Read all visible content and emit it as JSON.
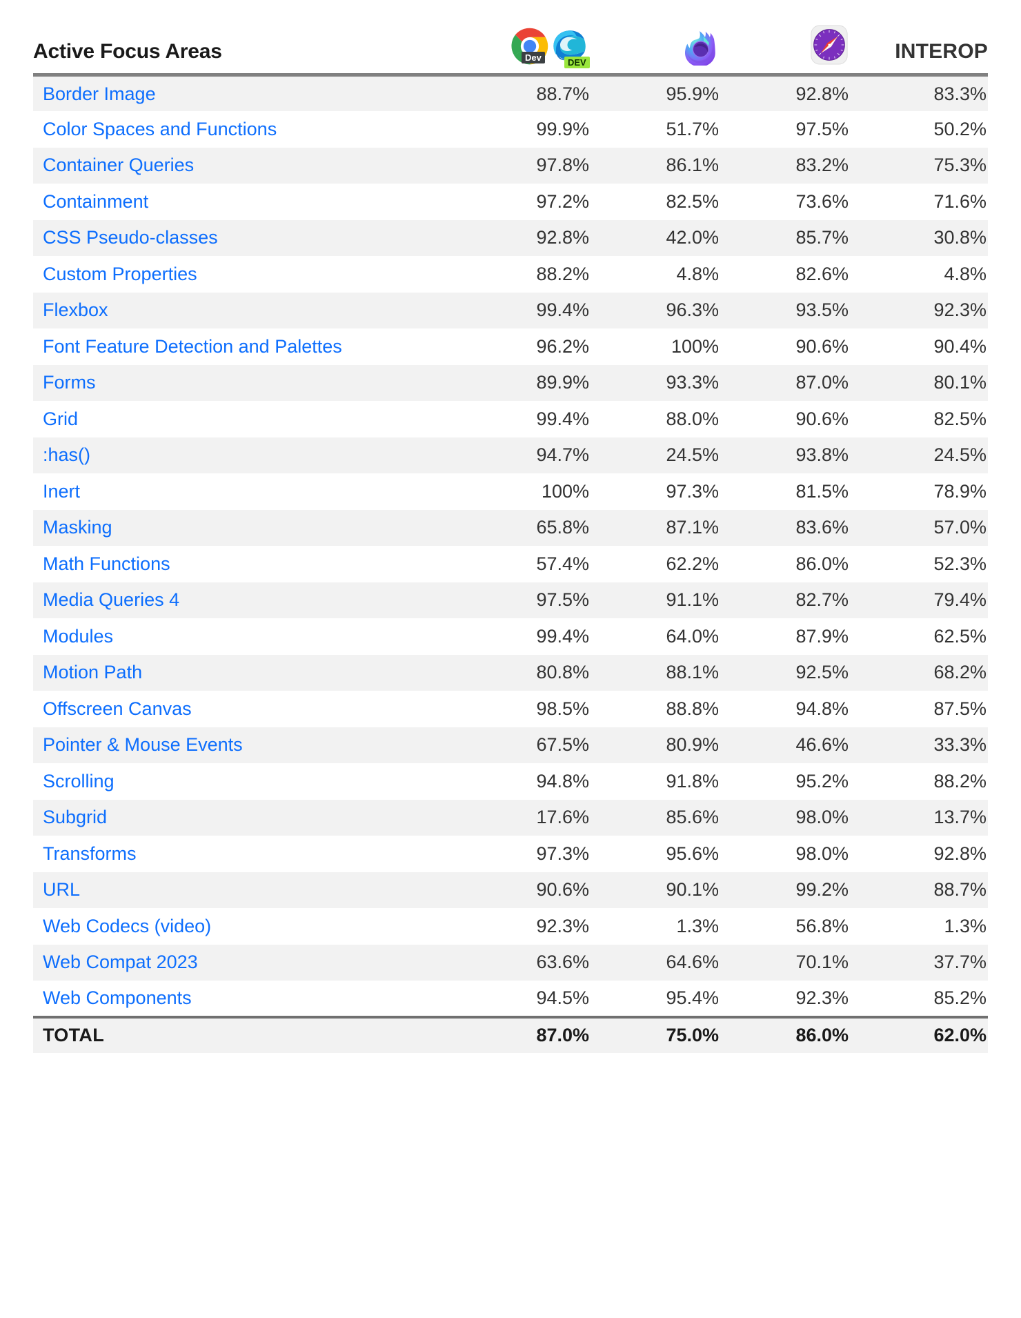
{
  "header": {
    "title": "Active Focus Areas",
    "interop_label": "INTEROP",
    "browsers": [
      {
        "name": "chrome-dev-and-edge-dev",
        "icons": [
          "chrome-dev-icon",
          "edge-dev-icon"
        ],
        "badge1": "Dev",
        "badge2": "DEV"
      },
      {
        "name": "firefox-nightly",
        "icons": [
          "firefox-nightly-icon"
        ]
      },
      {
        "name": "safari-technology-preview",
        "icons": [
          "safari-technology-preview-icon"
        ]
      }
    ],
    "columns": [
      "Active Focus Areas",
      "Chrome Dev / Edge Dev",
      "Firefox Nightly",
      "Safari Technology Preview",
      "INTEROP"
    ]
  },
  "colors": {
    "link": "#0d6efd",
    "text": "#333333",
    "row_alt_bg": "#f2f2f2",
    "header_rule": "#808080",
    "total_rule": "#707070"
  },
  "rows": [
    {
      "area": "Border Image",
      "chrome": "88.7%",
      "firefox": "95.9%",
      "safari": "92.8%",
      "interop": "83.3%"
    },
    {
      "area": "Color Spaces and Functions",
      "chrome": "99.9%",
      "firefox": "51.7%",
      "safari": "97.5%",
      "interop": "50.2%"
    },
    {
      "area": "Container Queries",
      "chrome": "97.8%",
      "firefox": "86.1%",
      "safari": "83.2%",
      "interop": "75.3%"
    },
    {
      "area": "Containment",
      "chrome": "97.2%",
      "firefox": "82.5%",
      "safari": "73.6%",
      "interop": "71.6%"
    },
    {
      "area": "CSS Pseudo-classes",
      "chrome": "92.8%",
      "firefox": "42.0%",
      "safari": "85.7%",
      "interop": "30.8%"
    },
    {
      "area": "Custom Properties",
      "chrome": "88.2%",
      "firefox": "4.8%",
      "safari": "82.6%",
      "interop": "4.8%"
    },
    {
      "area": "Flexbox",
      "chrome": "99.4%",
      "firefox": "96.3%",
      "safari": "93.5%",
      "interop": "92.3%"
    },
    {
      "area": "Font Feature Detection and Palettes",
      "chrome": "96.2%",
      "firefox": "100%",
      "safari": "90.6%",
      "interop": "90.4%"
    },
    {
      "area": "Forms",
      "chrome": "89.9%",
      "firefox": "93.3%",
      "safari": "87.0%",
      "interop": "80.1%"
    },
    {
      "area": "Grid",
      "chrome": "99.4%",
      "firefox": "88.0%",
      "safari": "90.6%",
      "interop": "82.5%"
    },
    {
      "area": ":has()",
      "chrome": "94.7%",
      "firefox": "24.5%",
      "safari": "93.8%",
      "interop": "24.5%"
    },
    {
      "area": "Inert",
      "chrome": "100%",
      "firefox": "97.3%",
      "safari": "81.5%",
      "interop": "78.9%"
    },
    {
      "area": "Masking",
      "chrome": "65.8%",
      "firefox": "87.1%",
      "safari": "83.6%",
      "interop": "57.0%"
    },
    {
      "area": "Math Functions",
      "chrome": "57.4%",
      "firefox": "62.2%",
      "safari": "86.0%",
      "interop": "52.3%"
    },
    {
      "area": "Media Queries 4",
      "chrome": "97.5%",
      "firefox": "91.1%",
      "safari": "82.7%",
      "interop": "79.4%"
    },
    {
      "area": "Modules",
      "chrome": "99.4%",
      "firefox": "64.0%",
      "safari": "87.9%",
      "interop": "62.5%"
    },
    {
      "area": "Motion Path",
      "chrome": "80.8%",
      "firefox": "88.1%",
      "safari": "92.5%",
      "interop": "68.2%"
    },
    {
      "area": "Offscreen Canvas",
      "chrome": "98.5%",
      "firefox": "88.8%",
      "safari": "94.8%",
      "interop": "87.5%"
    },
    {
      "area": "Pointer & Mouse Events",
      "chrome": "67.5%",
      "firefox": "80.9%",
      "safari": "46.6%",
      "interop": "33.3%"
    },
    {
      "area": "Scrolling",
      "chrome": "94.8%",
      "firefox": "91.8%",
      "safari": "95.2%",
      "interop": "88.2%"
    },
    {
      "area": "Subgrid",
      "chrome": "17.6%",
      "firefox": "85.6%",
      "safari": "98.0%",
      "interop": "13.7%"
    },
    {
      "area": "Transforms",
      "chrome": "97.3%",
      "firefox": "95.6%",
      "safari": "98.0%",
      "interop": "92.8%"
    },
    {
      "area": "URL",
      "chrome": "90.6%",
      "firefox": "90.1%",
      "safari": "99.2%",
      "interop": "88.7%"
    },
    {
      "area": "Web Codecs (video)",
      "chrome": "92.3%",
      "firefox": "1.3%",
      "safari": "56.8%",
      "interop": "1.3%"
    },
    {
      "area": "Web Compat 2023",
      "chrome": "63.6%",
      "firefox": "64.6%",
      "safari": "70.1%",
      "interop": "37.7%"
    },
    {
      "area": "Web Components",
      "chrome": "94.5%",
      "firefox": "95.4%",
      "safari": "92.3%",
      "interop": "85.2%"
    }
  ],
  "total": {
    "area": "TOTAL",
    "chrome": "87.0%",
    "firefox": "75.0%",
    "safari": "86.0%",
    "interop": "62.0%"
  },
  "chart_data": {
    "type": "table",
    "title": "Active Focus Areas",
    "columns": [
      "Active Focus Areas",
      "Chrome Dev / Edge Dev",
      "Firefox Nightly",
      "Safari Technology Preview",
      "INTEROP"
    ],
    "categories": [
      "Border Image",
      "Color Spaces and Functions",
      "Container Queries",
      "Containment",
      "CSS Pseudo-classes",
      "Custom Properties",
      "Flexbox",
      "Font Feature Detection and Palettes",
      "Forms",
      "Grid",
      ":has()",
      "Inert",
      "Masking",
      "Math Functions",
      "Media Queries 4",
      "Modules",
      "Motion Path",
      "Offscreen Canvas",
      "Pointer & Mouse Events",
      "Scrolling",
      "Subgrid",
      "Transforms",
      "URL",
      "Web Codecs (video)",
      "Web Compat 2023",
      "Web Components"
    ],
    "series": [
      {
        "name": "Chrome Dev / Edge Dev",
        "values": [
          88.7,
          99.9,
          97.8,
          97.2,
          92.8,
          88.2,
          99.4,
          96.2,
          89.9,
          99.4,
          94.7,
          100,
          65.8,
          57.4,
          97.5,
          99.4,
          80.8,
          98.5,
          67.5,
          94.8,
          17.6,
          97.3,
          90.6,
          92.3,
          63.6,
          94.5
        ],
        "total": 87.0
      },
      {
        "name": "Firefox Nightly",
        "values": [
          95.9,
          51.7,
          86.1,
          82.5,
          42.0,
          4.8,
          96.3,
          100,
          93.3,
          88.0,
          24.5,
          97.3,
          87.1,
          62.2,
          91.1,
          64.0,
          88.1,
          88.8,
          80.9,
          91.8,
          85.6,
          95.6,
          90.1,
          1.3,
          64.6,
          95.4
        ],
        "total": 75.0
      },
      {
        "name": "Safari Technology Preview",
        "values": [
          92.8,
          97.5,
          83.2,
          73.6,
          85.7,
          82.6,
          93.5,
          90.6,
          87.0,
          90.6,
          93.8,
          81.5,
          83.6,
          86.0,
          82.7,
          87.9,
          92.5,
          94.8,
          46.6,
          95.2,
          98.0,
          98.0,
          99.2,
          56.8,
          70.1,
          92.3
        ],
        "total": 86.0
      },
      {
        "name": "INTEROP",
        "values": [
          83.3,
          50.2,
          75.3,
          71.6,
          30.8,
          4.8,
          92.3,
          90.4,
          80.1,
          82.5,
          24.5,
          78.9,
          57.0,
          52.3,
          79.4,
          62.5,
          68.2,
          87.5,
          33.3,
          88.2,
          13.7,
          92.8,
          88.7,
          1.3,
          37.7,
          85.2
        ],
        "total": 62.0
      }
    ],
    "units": "percent",
    "ylim": [
      0,
      100
    ]
  }
}
